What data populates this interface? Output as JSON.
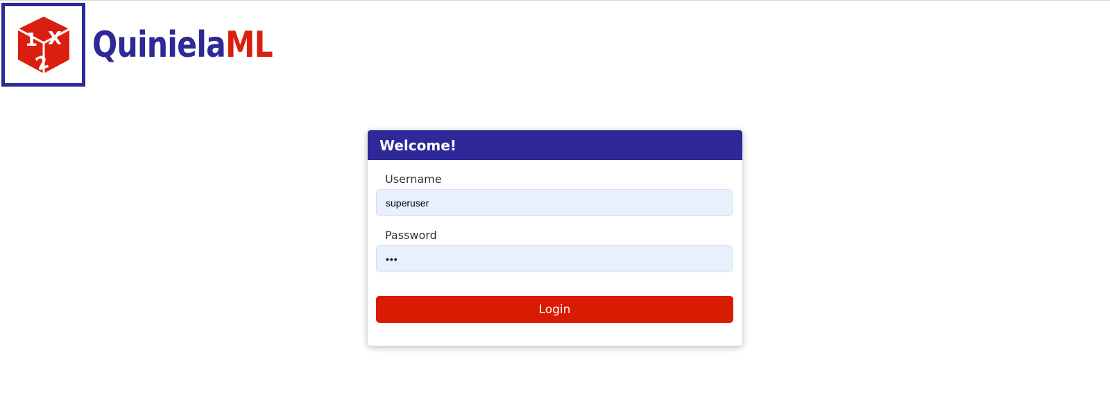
{
  "brand": {
    "name_part1": "Quiniela",
    "name_part2": "ML",
    "logo_glyphs": [
      "1",
      "X",
      "2"
    ],
    "primary_color": "#2d2997",
    "accent_color": "#db1f0f"
  },
  "login_card": {
    "title": "Welcome!",
    "username_label": "Username",
    "username_value": "superuser",
    "password_label": "Password",
    "password_value": "•••",
    "login_button": "Login"
  }
}
